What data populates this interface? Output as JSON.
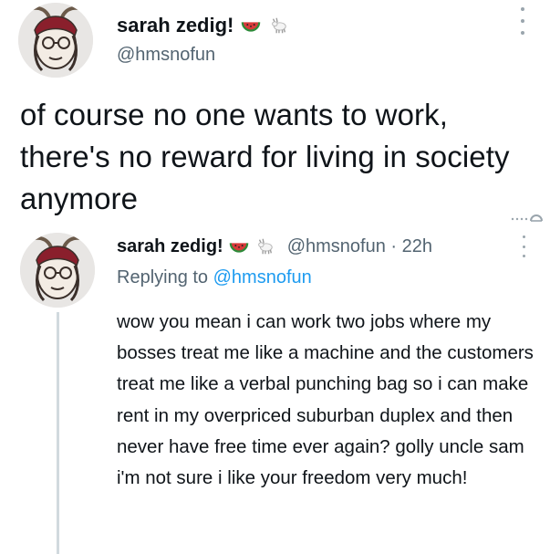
{
  "main_tweet": {
    "display_name": "sarah zedig!",
    "handle": "@hmsnofun",
    "text": "of course no one wants to work, there's no reward for living in society anymore"
  },
  "reply_tweet": {
    "display_name": "sarah zedig!",
    "handle": "@hmsnofun",
    "separator": "·",
    "time": "22h",
    "replying_to_label": "Replying to",
    "replying_to_handle": "@hmsnofun",
    "text": "wow you mean i can work two jobs where my bosses treat me like a machine and the customers treat me like a verbal punching bag so i can make rent in my overpriced suburban duplex and then never have free time ever again? golly uncle sam i'm not sure i like your freedom very much!"
  },
  "icons": {
    "name_emoji_1": "watermelon-icon",
    "name_emoji_2": "goat-icon",
    "more": "more-options-icon",
    "divider": "divider-mark-icon"
  },
  "colors": {
    "text_primary": "#0f1419",
    "text_secondary": "#536471",
    "link": "#1d9bf0",
    "thread_line": "#d1d9de",
    "background": "#ffffff"
  }
}
